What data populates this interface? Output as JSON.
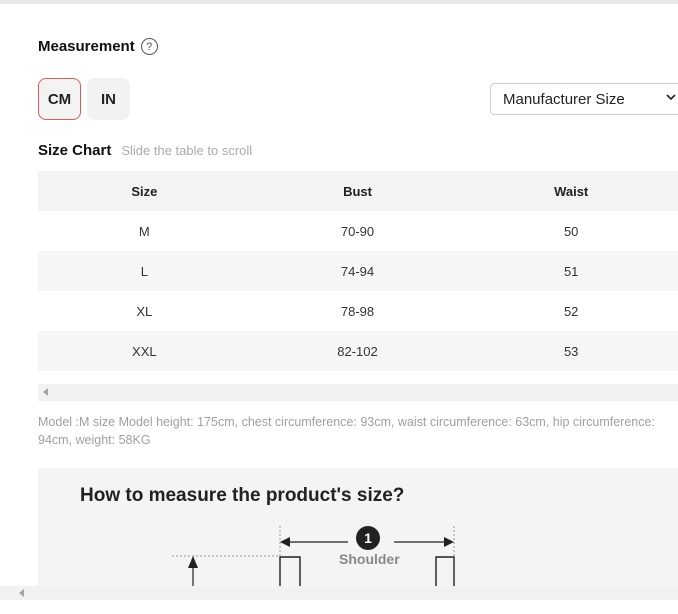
{
  "measurement": {
    "title": "Measurement",
    "help_glyph": "?"
  },
  "units": {
    "cm": "CM",
    "in": "IN",
    "active": "CM"
  },
  "size_select": {
    "selected": "Manufacturer Size"
  },
  "size_chart": {
    "title": "Size Chart",
    "hint": "Slide the table to scroll",
    "columns": [
      "Size",
      "Bust",
      "Waist"
    ],
    "rows": [
      [
        "M",
        "70-90",
        "50"
      ],
      [
        "L",
        "74-94",
        "51"
      ],
      [
        "XL",
        "78-98",
        "52"
      ],
      [
        "XXL",
        "82-102",
        "53"
      ]
    ]
  },
  "model_note": "Model :M size Model height: 175cm, chest circumference: 93cm, waist circumference: 63cm, hip circumference: 94cm, weight: 58KG",
  "guide": {
    "title": "How to measure the product's size?",
    "step_number": "1",
    "step_label": "Shoulder"
  },
  "colors": {
    "active_border": "#e05a5a",
    "muted_text": "#a0a0a0",
    "row_alt": "#f6f6f6"
  }
}
